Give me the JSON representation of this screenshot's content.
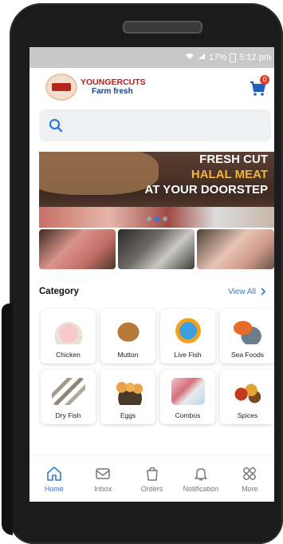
{
  "status_bar": {
    "battery": "17%",
    "time": "5:12 pm"
  },
  "header": {
    "brand_line1": "YOUNGERCUTS",
    "brand_line2": "Farm fresh",
    "logo_text": "YOUNGER CUTS",
    "cart_count": "0"
  },
  "search": {
    "placeholder": ""
  },
  "banner": {
    "line1": "FRESH CUT",
    "line2": "HALAL MEAT",
    "line3": "AT YOUR DOORSTEP",
    "dots": 3,
    "active_dot": 2
  },
  "category": {
    "title": "Category",
    "view_all": "View All",
    "items": [
      {
        "label": "Chicken"
      },
      {
        "label": "Mutton"
      },
      {
        "label": "Live Fish"
      },
      {
        "label": "Sea Foods"
      },
      {
        "label": "Dry Fish"
      },
      {
        "label": "Eggs"
      },
      {
        "label": "Combos"
      },
      {
        "label": "Spices"
      }
    ]
  },
  "bottom_nav": [
    {
      "label": "Home",
      "icon": "home-icon",
      "active": true
    },
    {
      "label": "Inbox",
      "icon": "inbox-icon",
      "active": false
    },
    {
      "label": "Orders",
      "icon": "bag-icon",
      "active": false
    },
    {
      "label": "Notification",
      "icon": "bell-icon",
      "active": false
    },
    {
      "label": "More",
      "icon": "grid-icon",
      "active": false
    }
  ],
  "colors": {
    "accent": "#2d7ad8",
    "brand_red": "#b7201b",
    "brand_blue": "#1f3f8a",
    "banner_yellow": "#f2b43a"
  }
}
